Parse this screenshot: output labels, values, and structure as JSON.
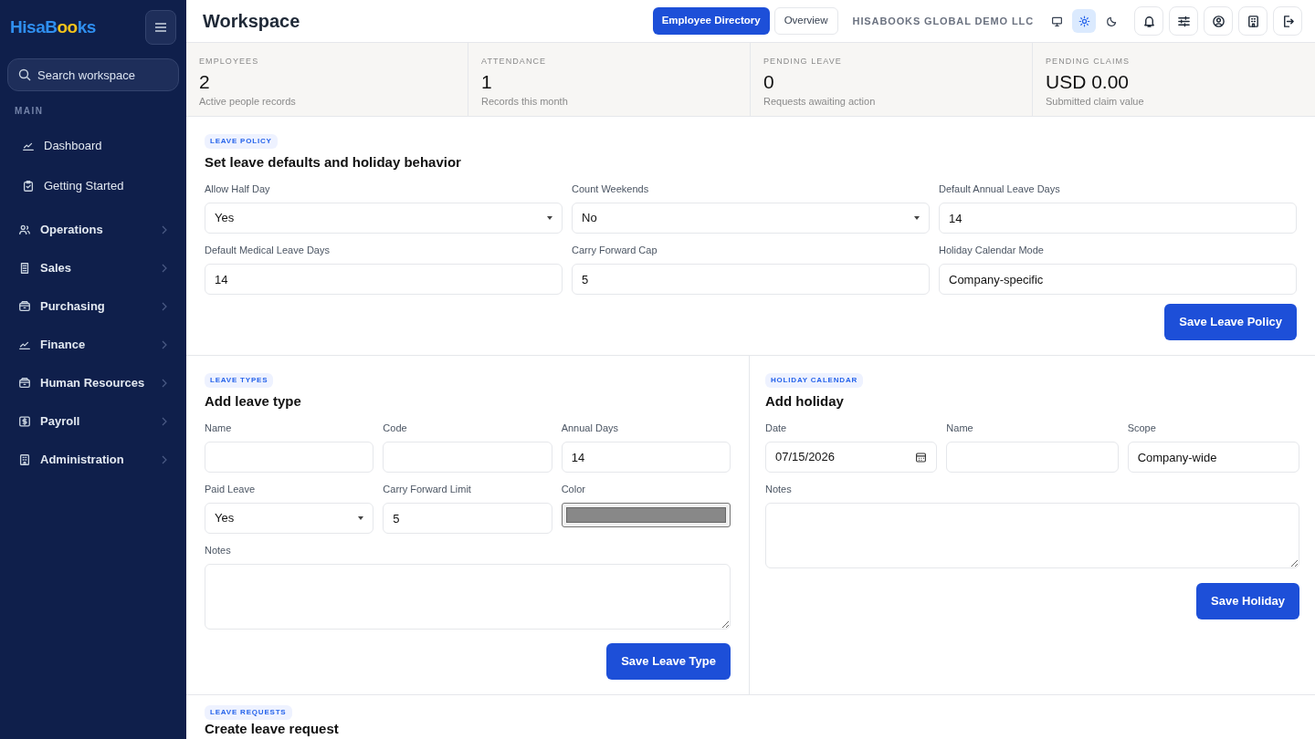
{
  "sidebar": {
    "logo": [
      {
        "text": "HisaB",
        "color": "#2f8ff0"
      },
      {
        "text": "oo",
        "color": "#f2c21b"
      },
      {
        "text": "ks",
        "color": "#2f8ff0"
      }
    ],
    "search": {
      "placeholder": "Search workspace"
    },
    "section_label": "MAIN",
    "main_items": [
      {
        "label": "Dashboard"
      },
      {
        "label": "Getting Started"
      }
    ],
    "groups": [
      {
        "label": "Operations",
        "expanded": false
      },
      {
        "label": "Sales",
        "expanded": false
      },
      {
        "label": "Purchasing",
        "expanded": false
      },
      {
        "label": "Finance",
        "expanded": false
      },
      {
        "label": "Human Resources",
        "expanded": false
      },
      {
        "label": "Payroll",
        "expanded": false
      },
      {
        "label": "Administration",
        "expanded": false
      }
    ]
  },
  "header": {
    "title": "Workspace",
    "buttons": [
      {
        "label": "Employee Directory",
        "selected": true
      },
      {
        "label": "Overview",
        "selected": false
      }
    ],
    "company": "HISABOOKS GLOBAL DEMO LLC",
    "theme_modes": [
      {
        "selected": false
      },
      {
        "selected": true
      },
      {
        "selected": false
      }
    ]
  },
  "stats": [
    {
      "label": "EMPLOYEES",
      "value": "2",
      "caption": "Active people records"
    },
    {
      "label": "ATTENDANCE",
      "value": "1",
      "caption": "Records this month"
    },
    {
      "label": "PENDING LEAVE",
      "value": "0",
      "caption": "Requests awaiting action"
    },
    {
      "label": "PENDING CLAIMS",
      "value": "USD 0.00",
      "caption": "Submitted claim value"
    }
  ],
  "leave_policy": {
    "tag": "LEAVE POLICY",
    "title": "Set leave defaults and holiday behavior",
    "fields": [
      {
        "label": "Allow Half Day",
        "kind": "select",
        "value": "Yes"
      },
      {
        "label": "Count Weekends",
        "kind": "select",
        "value": "No"
      },
      {
        "label": "Default Annual Leave Days",
        "kind": "input",
        "value": "14"
      },
      {
        "label": "Default Medical Leave Days",
        "kind": "input",
        "value": "14"
      },
      {
        "label": "Carry Forward Cap",
        "kind": "input",
        "value": "5"
      },
      {
        "label": "Holiday Calendar Mode",
        "kind": "input",
        "value": "Company-specific"
      }
    ],
    "button": "Save Leave Policy"
  },
  "leave_types": {
    "tag": "LEAVE TYPES",
    "title": "Add leave type",
    "fields": [
      {
        "label": "Name",
        "kind": "input"
      },
      {
        "label": "Code",
        "kind": "input"
      },
      {
        "label": "Annual Days",
        "kind": "input",
        "value": "14"
      },
      {
        "label": "Paid Leave",
        "kind": "select",
        "value": "Yes"
      },
      {
        "label": "Carry Forward Limit",
        "kind": "input",
        "value": "5"
      },
      {
        "label": "Color",
        "kind": "color",
        "color": "#888888"
      },
      {
        "label": "Notes",
        "kind": "textarea"
      }
    ],
    "button": "Save Leave Type"
  },
  "holiday_calendar": {
    "tag": "HOLIDAY CALENDAR",
    "title": "Add holiday",
    "fields": [
      {
        "label": "Date",
        "kind": "date",
        "value": "07/15/2026"
      },
      {
        "label": "Name",
        "kind": "input"
      },
      {
        "label": "Scope",
        "kind": "input",
        "value": "Company-wide"
      },
      {
        "label": "Notes",
        "kind": "textarea"
      }
    ],
    "button": "Save Holiday"
  },
  "leave_requests": {
    "tag": "LEAVE REQUESTS",
    "title": "Create leave request"
  }
}
